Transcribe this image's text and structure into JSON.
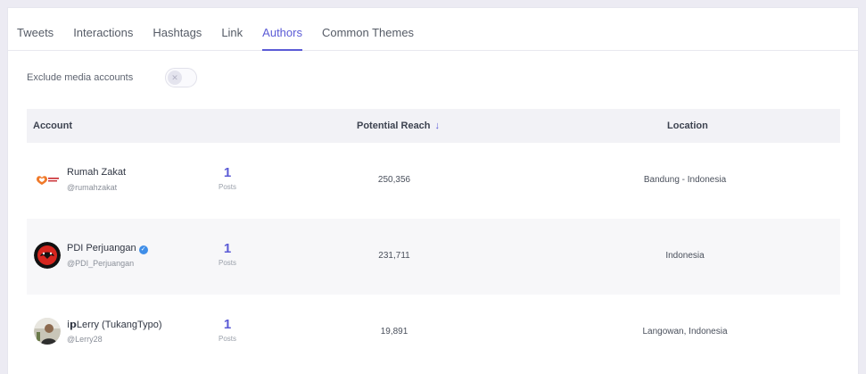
{
  "tabs": [
    {
      "label": "Tweets",
      "active": false
    },
    {
      "label": "Interactions",
      "active": false
    },
    {
      "label": "Hashtags",
      "active": false
    },
    {
      "label": "Link",
      "active": false
    },
    {
      "label": "Authors",
      "active": true
    },
    {
      "label": "Common Themes",
      "active": false
    }
  ],
  "filter": {
    "label": "Exclude media accounts",
    "enabled": false
  },
  "table": {
    "headers": {
      "account": "Account",
      "reach": "Potential Reach",
      "location": "Location"
    },
    "sort_icon": "arrow-down-icon",
    "rows": [
      {
        "name": "Rumah Zakat",
        "handle": "@rumahzakat",
        "verified": false,
        "posts": "1",
        "posts_label": "Posts",
        "reach": "250,356",
        "location": "Bandung - Indonesia",
        "avatar_logo_text": "Rumah Zakat"
      },
      {
        "name": "PDI Perjuangan",
        "handle": "@PDI_Perjuangan",
        "verified": true,
        "posts": "1",
        "posts_label": "Posts",
        "reach": "231,711",
        "location": "Indonesia"
      },
      {
        "name": "𝗂𝗽Lerry (TukangTypo)",
        "handle": "@Lerry28",
        "verified": false,
        "posts": "1",
        "posts_label": "Posts",
        "reach": "19,891",
        "location": "Langowan, Indonesia"
      }
    ]
  },
  "colors": {
    "accent": "#5b5bd6",
    "verified": "#3f8ee8",
    "header_bg": "#f2f2f6",
    "alt_row": "#f7f7f9"
  }
}
